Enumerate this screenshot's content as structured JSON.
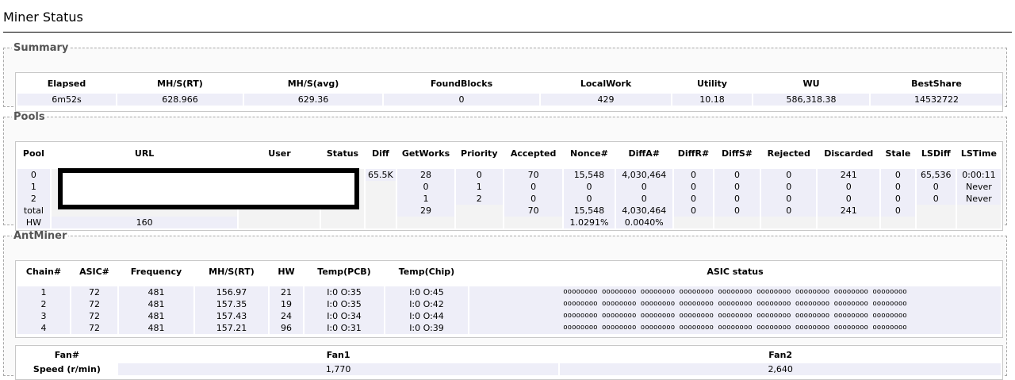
{
  "page": {
    "title": "Miner Status"
  },
  "summary": {
    "legend": "Summary",
    "headers": [
      "Elapsed",
      "MH/S(RT)",
      "MH/S(avg)",
      "FoundBlocks",
      "LocalWork",
      "Utility",
      "WU",
      "BestShare"
    ],
    "values": [
      "6m52s",
      "628.966",
      "629.36",
      "0",
      "429",
      "10.18",
      "586,318.38",
      "14532722"
    ]
  },
  "pools": {
    "legend": "Pools",
    "headers": [
      "Pool",
      "URL",
      "User",
      "Status",
      "Diff",
      "GetWorks",
      "Priority",
      "Accepted",
      "Nonce#",
      "DiffA#",
      "DiffR#",
      "DiffS#",
      "Rejected",
      "Discarded",
      "Stale",
      "LSDiff",
      "LSTime"
    ],
    "rows": [
      [
        "0",
        "",
        "",
        "",
        "65.5K",
        "28",
        "0",
        "70",
        "15,548",
        "4,030,464",
        "0",
        "0",
        "0",
        "241",
        "0",
        "65,536",
        "0:00:11"
      ],
      [
        "1",
        "",
        "",
        "",
        "",
        "0",
        "1",
        "0",
        "0",
        "0",
        "0",
        "0",
        "0",
        "0",
        "0",
        "0",
        "Never"
      ],
      [
        "2",
        "",
        "",
        "",
        "",
        "1",
        "2",
        "0",
        "0",
        "0",
        "0",
        "0",
        "0",
        "0",
        "0",
        "0",
        "Never"
      ],
      [
        "total",
        "",
        "",
        "",
        "",
        "29",
        "",
        "70",
        "15,548",
        "4,030,464",
        "0",
        "0",
        "0",
        "241",
        "0",
        "",
        ""
      ],
      [
        "HW",
        "160",
        "",
        "",
        "",
        "",
        "",
        "",
        "1.0291%",
        "0.0040%",
        "",
        "",
        "",
        "",
        "",
        "",
        ""
      ]
    ]
  },
  "antminer": {
    "legend": "AntMiner",
    "headers": [
      "Chain#",
      "ASIC#",
      "Frequency",
      "MH/S(RT)",
      "HW",
      "Temp(PCB)",
      "Temp(Chip)",
      "ASIC status"
    ],
    "rows": [
      [
        "1",
        "72",
        "481",
        "156.97",
        "21",
        "I:0 O:35",
        "I:0 O:45",
        "oooooooo oooooooo oooooooo oooooooo oooooooo oooooooo oooooooo oooooooo oooooooo"
      ],
      [
        "2",
        "72",
        "481",
        "157.35",
        "19",
        "I:0 O:35",
        "I:0 O:42",
        "oooooooo oooooooo oooooooo oooooooo oooooooo oooooooo oooooooo oooooooo oooooooo"
      ],
      [
        "3",
        "72",
        "481",
        "157.43",
        "24",
        "I:0 O:34",
        "I:0 O:44",
        "oooooooo oooooooo oooooooo oooooooo oooooooo oooooooo oooooooo oooooooo oooooooo"
      ],
      [
        "4",
        "72",
        "481",
        "157.21",
        "96",
        "I:0 O:31",
        "I:0 O:39",
        "oooooooo oooooooo oooooooo oooooooo oooooooo oooooooo oooooooo oooooooo oooooooo"
      ]
    ],
    "fans": {
      "headers": [
        "Fan#",
        "Fan1",
        "Fan2"
      ],
      "row_label": "Speed (r/min)",
      "values": [
        "1,770",
        "2,640"
      ]
    }
  }
}
